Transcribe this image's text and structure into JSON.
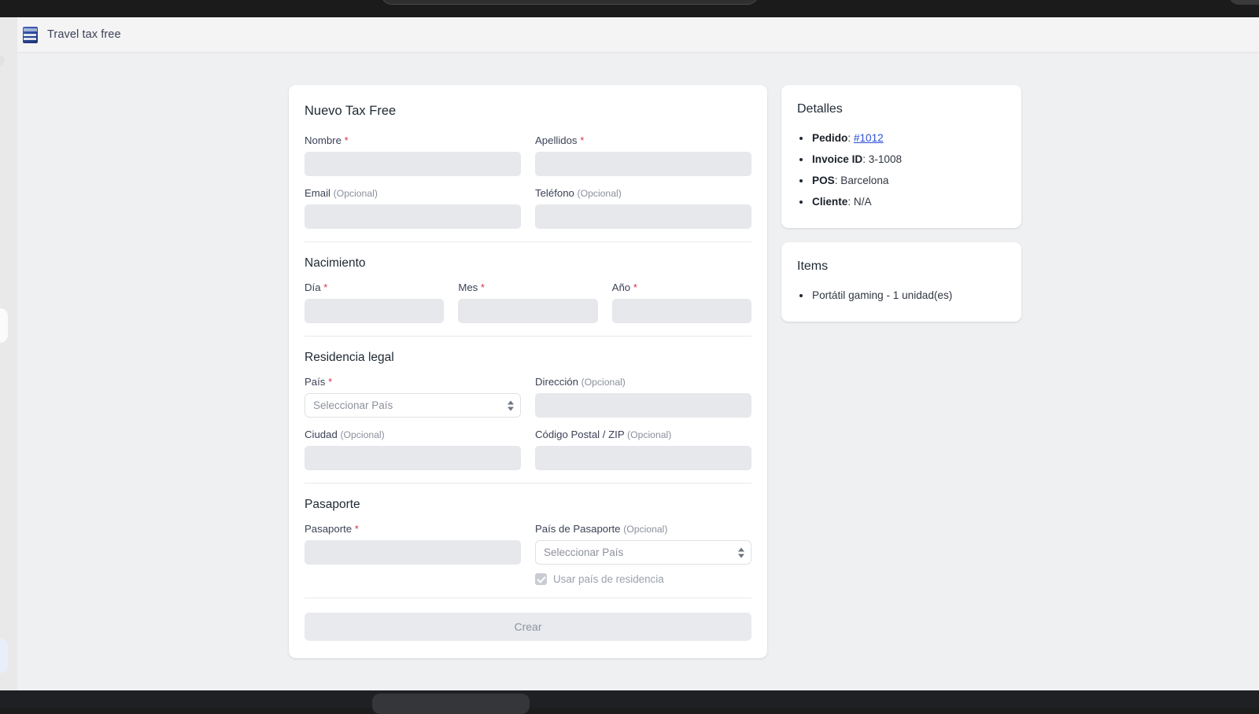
{
  "browser": {
    "chrome_color": "#1b1b1b"
  },
  "header": {
    "brand_title": "Travel tax free",
    "logo_name": "travel-tax-free-logo"
  },
  "form": {
    "title": "Nuevo Tax Free",
    "optional_tag": "(Opcional)",
    "required_mark": "*",
    "personal": {
      "nombre_label": "Nombre",
      "nombre_value": "",
      "apellidos_label": "Apellidos",
      "apellidos_value": "",
      "email_label": "Email",
      "email_value": "",
      "telefono_label": "Teléfono",
      "telefono_value": ""
    },
    "nacimiento": {
      "section_title": "Nacimiento",
      "dia_label": "Día",
      "dia_value": "",
      "mes_label": "Mes",
      "mes_value": "",
      "anio_label": "Año",
      "anio_value": ""
    },
    "residencia": {
      "section_title": "Residencia legal",
      "pais_label": "País",
      "pais_selected": "Seleccionar País",
      "direccion_label": "Dirección",
      "direccion_value": "",
      "ciudad_label": "Ciudad",
      "ciudad_value": "",
      "cp_label": "Código Postal / ZIP",
      "cp_value": ""
    },
    "pasaporte": {
      "section_title": "Pasaporte",
      "pasaporte_label": "Pasaporte",
      "pasaporte_value": "",
      "pais_pasaporte_label": "País de Pasaporte",
      "pais_pasaporte_selected": "Seleccionar País",
      "usar_residencia_label": "Usar país de residencia",
      "usar_residencia_checked": true
    },
    "submit_label": "Crear",
    "submit_disabled": true
  },
  "details_panel": {
    "title": "Detalles",
    "items": [
      {
        "key": "Pedido",
        "sep": ": ",
        "value": "#1012",
        "is_link": true
      },
      {
        "key": "Invoice ID",
        "sep": ": ",
        "value": "3-1008",
        "is_link": false
      },
      {
        "key": "POS",
        "sep": ": ",
        "value": "Barcelona",
        "is_link": false
      },
      {
        "key": "Cliente",
        "sep": ": ",
        "value": "N/A",
        "is_link": false
      }
    ]
  },
  "items_panel": {
    "title": "Items",
    "items": [
      "Portátil gaming - 1 unidad(es)"
    ]
  },
  "colors": {
    "page_bg": "#eff0f2",
    "card_bg": "#ffffff",
    "input_bg": "#e6e8eb",
    "required_red": "#d6324b",
    "link_blue": "#2b4fd8",
    "text_dark": "#1f2933"
  }
}
